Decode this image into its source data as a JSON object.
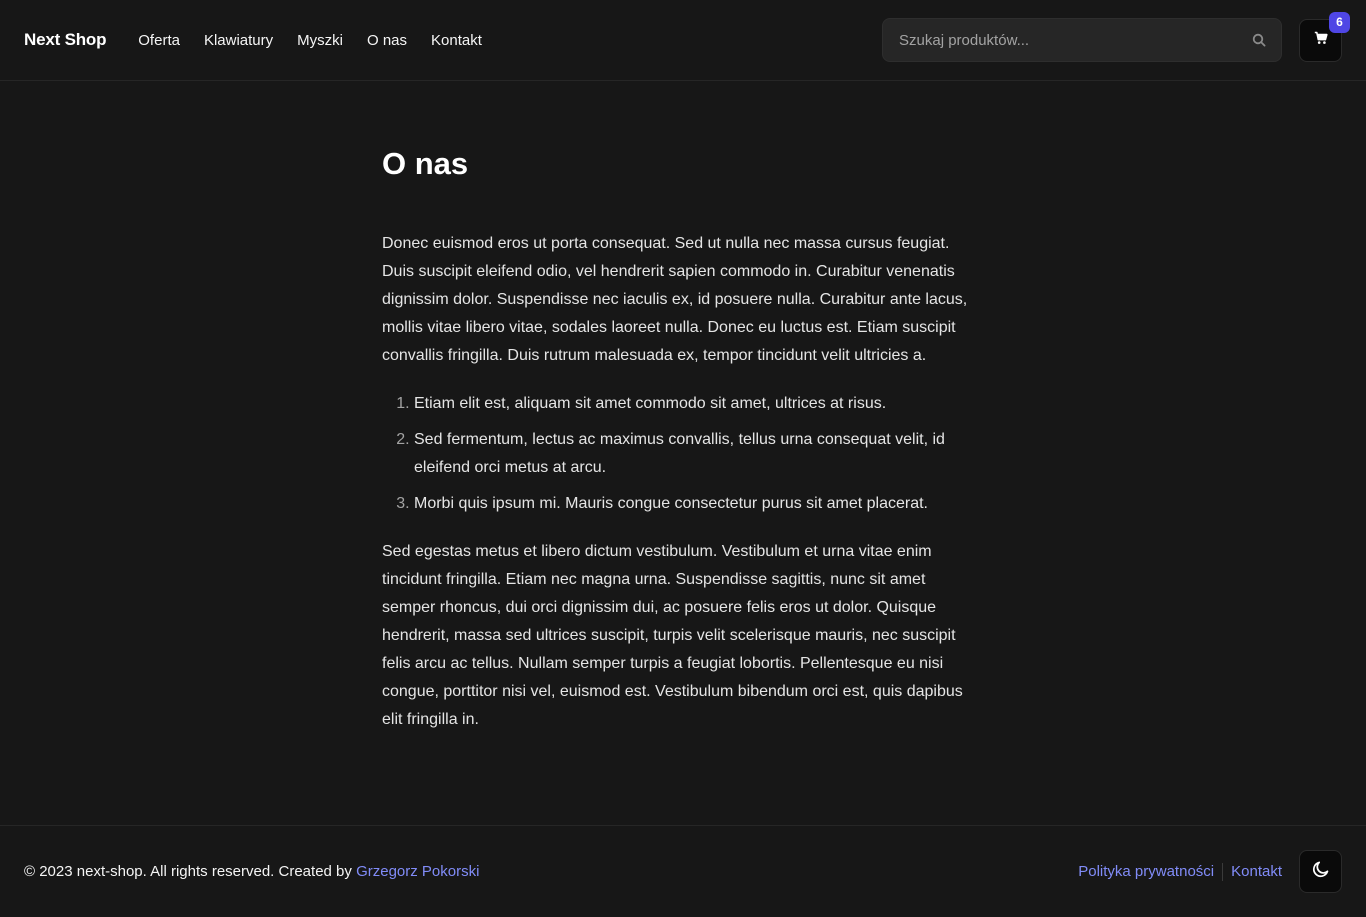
{
  "header": {
    "logo": "Next Shop",
    "nav": [
      {
        "label": "Oferta"
      },
      {
        "label": "Klawiatury"
      },
      {
        "label": "Myszki"
      },
      {
        "label": "O nas"
      },
      {
        "label": "Kontakt"
      }
    ],
    "search": {
      "placeholder": "Szukaj produktów...",
      "value": ""
    },
    "cart": {
      "count": "6",
      "icon": "cart-icon"
    },
    "search_icon": "search-icon"
  },
  "main": {
    "title": "O nas",
    "paragraph1": "Donec euismod eros ut porta consequat. Sed ut nulla nec massa cursus feugiat. Duis suscipit eleifend odio, vel hendrerit sapien commodo in. Curabitur venenatis dignissim dolor. Suspendisse nec iaculis ex, id posuere nulla. Curabitur ante lacus, mollis vitae libero vitae, sodales laoreet nulla. Donec eu luctus est. Etiam suscipit convallis fringilla. Duis rutrum malesuada ex, tempor tincidunt velit ultricies a.",
    "list": [
      "Etiam elit est, aliquam sit amet commodo sit amet, ultrices at risus.",
      "Sed fermentum, lectus ac maximus convallis, tellus urna consequat velit, id eleifend orci metus at arcu.",
      "Morbi quis ipsum mi. Mauris congue consectetur purus sit amet placerat."
    ],
    "paragraph2": "Sed egestas metus et libero dictum vestibulum. Vestibulum et urna vitae enim tincidunt fringilla. Etiam nec magna urna. Suspendisse sagittis, nunc sit amet semper rhoncus, dui orci dignissim dui, ac posuere felis eros ut dolor. Quisque hendrerit, massa sed ultrices suscipit, turpis velit scelerisque mauris, nec suscipit felis arcu ac tellus. Nullam semper turpis a feugiat lobortis. Pellentesque eu nisi congue, porttitor nisi vel, euismod est. Vestibulum bibendum orci est, quis dapibus elit fringilla in."
  },
  "footer": {
    "copyright_prefix": "© 2023 next-shop. All rights reserved. Created by ",
    "author": "Grzegorz Pokorski",
    "links": [
      {
        "label": "Polityka prywatności"
      },
      {
        "label": "Kontakt"
      }
    ],
    "theme_icon": "moon-icon"
  },
  "colors": {
    "background": "#171717",
    "accent": "#4f46e5",
    "link": "#818cf8"
  }
}
